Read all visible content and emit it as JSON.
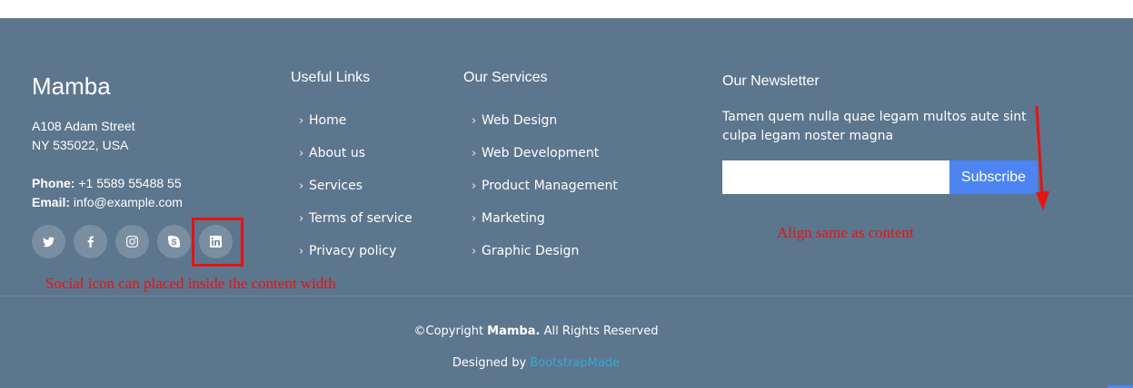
{
  "brand": {
    "name": "Mamba"
  },
  "contact": {
    "street": "A108 Adam Street",
    "city": "NY 535022, USA",
    "phone_label": "Phone:",
    "phone": "+1 5589 55488 55",
    "email_label": "Email:",
    "email": "info@example.com"
  },
  "social": [
    {
      "icon": "twitter-icon"
    },
    {
      "icon": "facebook-icon"
    },
    {
      "icon": "instagram-icon"
    },
    {
      "icon": "skype-icon"
    },
    {
      "icon": "linkedin-icon"
    }
  ],
  "useful_links": {
    "title": "Useful Links",
    "items": [
      "Home",
      "About us",
      "Services",
      "Terms of service",
      "Privacy policy"
    ]
  },
  "services": {
    "title": "Our Services",
    "items": [
      "Web Design",
      "Web Development",
      "Product Management",
      "Marketing",
      "Graphic Design"
    ]
  },
  "newsletter": {
    "title": "Our Newsletter",
    "description": "Tamen quem nulla quae legam multos aute sint culpa legam noster magna",
    "input_value": "",
    "button": "Subscribe"
  },
  "annotations": {
    "social": "Social icon can placed inside the content width",
    "align": "Align same as content"
  },
  "copyright": {
    "prefix": "©Copyright ",
    "brand": "Mamba.",
    "suffix": " All Rights Reserved",
    "designed_by": "Designed by ",
    "credit": "BootstrapMade"
  },
  "colors": {
    "footer_bg": "#5c768d",
    "button": "#4d84f2",
    "annotation": "#e81212",
    "credit_link": "#38a6d8"
  }
}
